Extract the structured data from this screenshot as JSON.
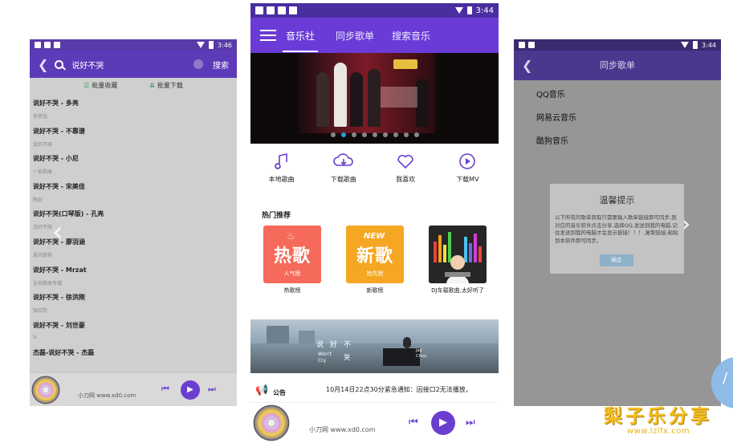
{
  "left_phone": {
    "status_time": "3:46",
    "search_query": "说好不哭",
    "search_button": "搜索",
    "batch": [
      "批量收藏",
      "批量下载"
    ],
    "songs": [
      {
        "title": "说好不哭 - 多亮",
        "artist": "多亮话"
      },
      {
        "title": "说好不哭 - 不靠谱",
        "artist": "说好不哭"
      },
      {
        "title": "说好不哭 - 小尼",
        "artist": "一首歌曲"
      },
      {
        "title": "说好不哭 - 宋美佳",
        "artist": "陶安"
      },
      {
        "title": "说好不哭(口琴版) - 孔亮",
        "artist": "说好不哭"
      },
      {
        "title": "说好不哭 - 廖羽涵",
        "artist": "夏的旅程"
      },
      {
        "title": "说好不哭 - Mrzat",
        "artist": "吉他歌曲专辑"
      },
      {
        "title": "说好不哭 - 徐洪刚",
        "artist": "独红院"
      },
      {
        "title": "说好不哭 - 刘世豪",
        "artist": "lv"
      },
      {
        "title": "杰磊-说好不哭 - 杰磊",
        "artist": ""
      }
    ],
    "player_site": "小刀网 www.xd0.com"
  },
  "center_phone": {
    "status_time": "3:44",
    "tabs": [
      "音乐社",
      "同步歌单",
      "搜索音乐"
    ],
    "quick_actions": [
      {
        "label": "本地歌曲",
        "icon": "music-note-icon"
      },
      {
        "label": "下载歌曲",
        "icon": "cloud-download-icon"
      },
      {
        "label": "我喜欢",
        "icon": "heart-icon"
      },
      {
        "label": "下载MV",
        "icon": "play-circle-icon"
      }
    ],
    "section_title": "热门推荐",
    "recommend": [
      {
        "big": "热歌",
        "small": "人气榜",
        "label": "热歌榜",
        "color": "#f56a5a"
      },
      {
        "big": "新歌",
        "small": "抢先榜",
        "label": "新歌榜",
        "color": "#f5a623"
      },
      {
        "big": "",
        "small": "",
        "label": "DJ车载歌曲,太好听了",
        "color": "#2a2a2a"
      }
    ],
    "banner2_text": [
      "说",
      "好",
      "不",
      "Won't",
      "Cry",
      "哭",
      "Jay",
      "Chou"
    ],
    "notice_title": "公告",
    "notice_text": "10月14日22点30分紧急通知：因接口2无法播放，",
    "player_site": "小刀网 www.xd0.com",
    "banner_dots": 9,
    "banner_active_dot": 1
  },
  "right_phone": {
    "status_time": "3:44",
    "title": "同步歌单",
    "items": [
      "QQ音乐",
      "网易云音乐",
      "酷狗音乐"
    ],
    "dialog": {
      "title": "温馨提示",
      "body": "以下所有的歌单获取只需要输入歌单链接即可同步,到对应的音乐软件点击分享,选择QQ,发送到我的电脑,记住发送到我的电脑才会显示链接！！！,复制链接,粘贴到本软件即可同步。",
      "ok": "确定"
    }
  },
  "watermark": {
    "text": "梨子乐分享",
    "url": "www.lzlfx.com"
  }
}
